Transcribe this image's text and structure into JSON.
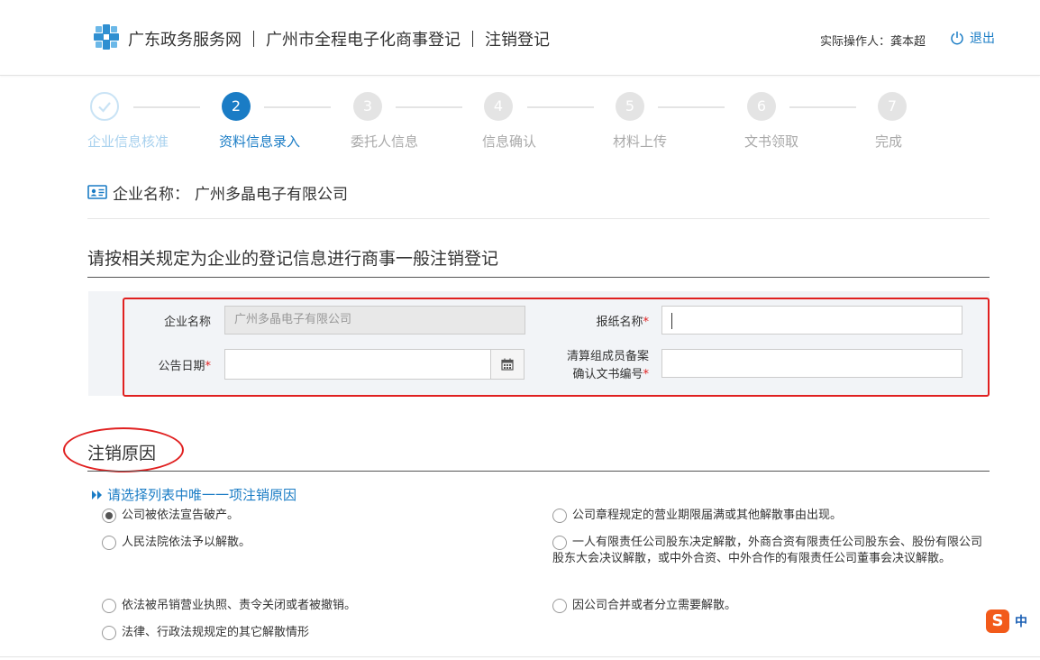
{
  "header": {
    "site": "广东政务服务网",
    "system": "广州市全程电子化商事登记",
    "module": "注销登记",
    "operator": "实际操作人：龚本超",
    "logout": "退出"
  },
  "steps": [
    {
      "num": "",
      "label": "企业信息核准",
      "state": "done"
    },
    {
      "num": "2",
      "label": "资料信息录入",
      "state": "active"
    },
    {
      "num": "3",
      "label": "委托人信息",
      "state": "pending"
    },
    {
      "num": "4",
      "label": "信息确认",
      "state": "pending"
    },
    {
      "num": "5",
      "label": "材料上传",
      "state": "pending"
    },
    {
      "num": "6",
      "label": "文书领取",
      "state": "pending"
    },
    {
      "num": "7",
      "label": "完成",
      "state": "pending"
    }
  ],
  "company": {
    "label": "企业名称：",
    "name": "广州多晶电子有限公司"
  },
  "section_title": "请按相关规定为企业的登记信息进行商事一般注销登记",
  "form": {
    "company_label": "企业名称",
    "company_value": "广州多晶电子有限公司",
    "newspaper_label": "报纸名称",
    "date_label": "公告日期",
    "filing_label_1": "清算组成员备案",
    "filing_label_2": "确认文书编号",
    "required_mark": "*"
  },
  "reason": {
    "title": "注销原因",
    "hint": "请选择列表中唯一一项注销原因",
    "options": [
      "公司被依法宣告破产。",
      "公司章程规定的营业期限届满或其他解散事由出现。",
      "人民法院依法予以解散。",
      "一人有限责任公司股东决定解散，外商合资有限责任公司股东会、股份有限公司股东大会决议解散，或中外合资、中外合作的有限责任公司董事会决议解散。",
      "依法被吊销营业执照、责令关闭或者被撤销。",
      "因公司合并或者分立需要解散。",
      "法律、行政法规规定的其它解散情形"
    ],
    "selected_index": 0
  },
  "ime": {
    "logo": "S",
    "mode": "中"
  },
  "colors": {
    "accent": "#1a7cc5",
    "annotation_red": "#e02020",
    "pending_step": "#e4e4e4"
  }
}
